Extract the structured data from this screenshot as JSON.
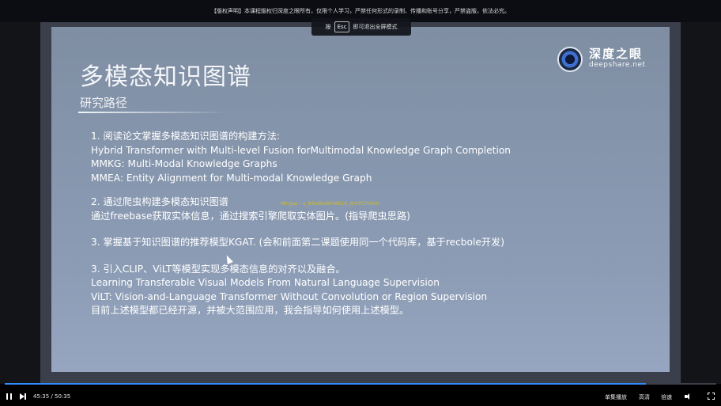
{
  "notice": "【版权声明】本课程版权归深度之眼所有，仅限个人学习，严禁任何形式的录制、传播和账号分享，严禁盗版，依法必究。",
  "esc_hint": {
    "pre": "按",
    "key": "Esc",
    "post": "即可退出全屏模式"
  },
  "slide": {
    "title": "多模态知识图谱",
    "subtitle": "研究路径",
    "logo": {
      "cn": "深度之眼",
      "en": "deepshare.net"
    },
    "lines": [
      "1.  阅读论文掌握多模态知识图谱的构建方法:",
      "Hybrid Transformer with Multi-level Fusion forMultimodal Knowledge Graph Completion",
      "MMKG: Multi-Modal Knowledge Graphs",
      "MMEA: Entity Alignment for Multi-modal Knowledge Graph",
      "2.  通过爬虫构建多模态知识图谱",
      "通过freebase获取实体信息，通过搜索引擎爬取实体图片。(指导爬虫思路)",
      "3. 掌握基于知识图谱的推荐模型KGAT. (会和前面第二课题使用同一个代码库，基于recbole开发)",
      "3.  引入CLIP、ViLT等模型实现多模态信息的对齐以及融合。",
      "Learning Transferable Visual Models From Natural Language Supervision",
      "ViLT: Vision-and-Language Transformer Without Convolution or Region Supervision",
      "目前上述模型都已经开源，并被大范围应用，我会指导如何使用上述模型。"
    ],
    "watermark": "Mingao - u_64bd6e8549614_dcVPCHVb0r"
  },
  "player": {
    "current_time": "45:35",
    "total_time": "50:35",
    "progress": 0.901,
    "single_play_label": "单集播放",
    "quality_label": "高清",
    "speed_label": "倍速"
  }
}
